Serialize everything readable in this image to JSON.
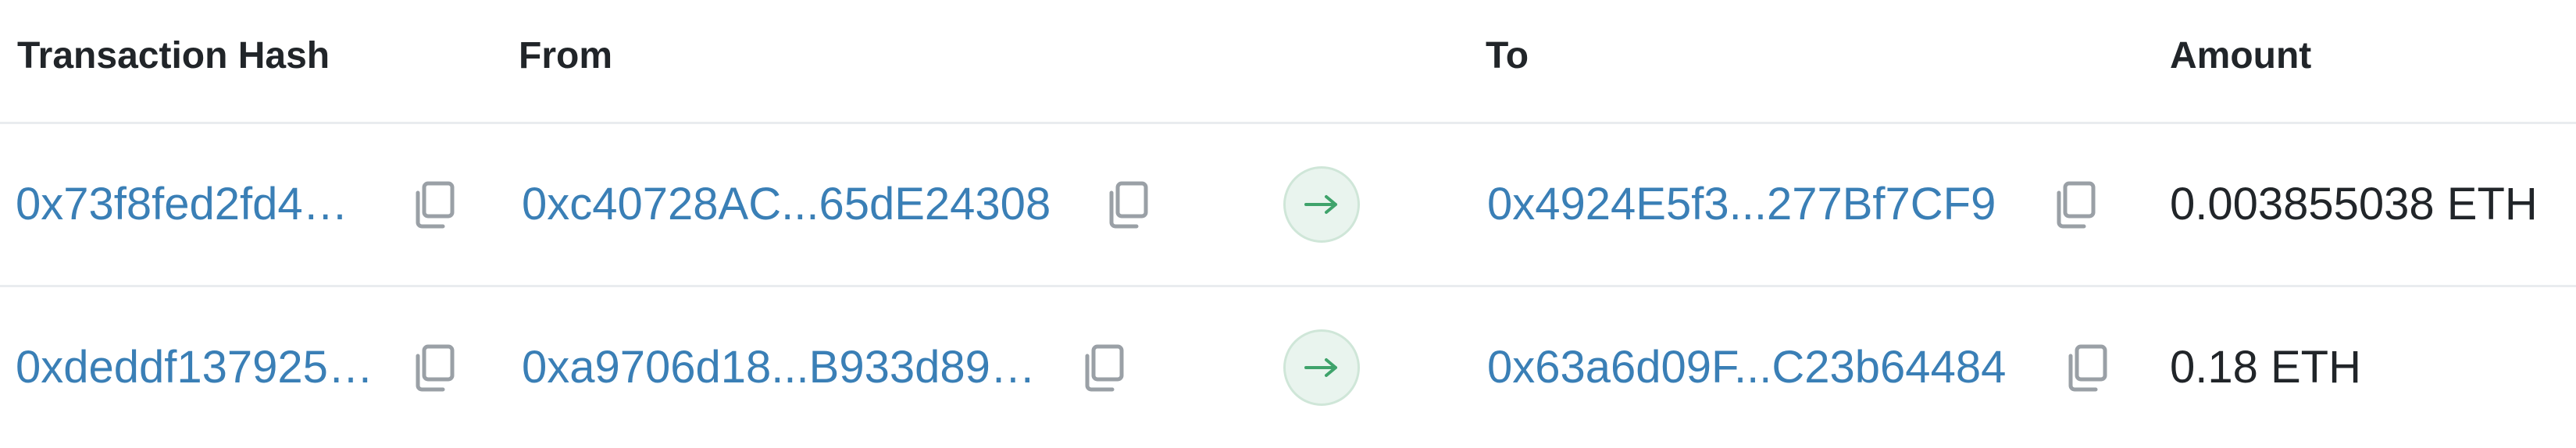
{
  "table": {
    "headers": {
      "hash": "Transaction Hash",
      "from": "From",
      "to": "To",
      "amount": "Amount"
    },
    "rows": [
      {
        "hash": "0x73f8fed2fd4…",
        "from": "0xc40728AC...65dE24308",
        "to": "0x4924E5f3...277Bf7CF9",
        "amount": "0.003855038 ETH"
      },
      {
        "hash": "0xdeddf137925…",
        "from": "0xa9706d18...B933d89…",
        "to": "0x63a6d09F...C23b64484",
        "amount": "0.18 ETH"
      }
    ]
  },
  "colors": {
    "link": "#3a7fb6",
    "text": "#212529",
    "divider": "#e9ecef",
    "arrow_bg": "#e9f4ee",
    "arrow_fg": "#3fa36b",
    "icon": "#9aa0a6"
  },
  "icons": {
    "copy": "copy-icon",
    "transfer": "arrow-right-icon"
  }
}
